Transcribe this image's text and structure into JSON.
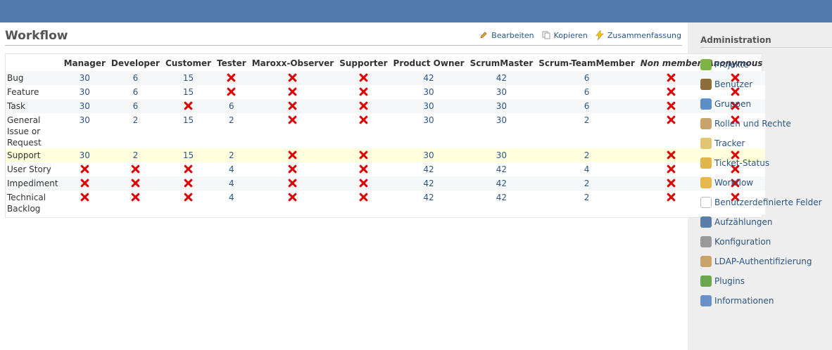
{
  "page": {
    "title": "Workflow",
    "actions": {
      "edit": "Bearbeiten",
      "copy": "Kopieren",
      "summary": "Zusammenfassung"
    }
  },
  "workflow": {
    "columns": [
      "Manager",
      "Developer",
      "Customer",
      "Tester",
      "Maroxx-Observer",
      "Supporter",
      "Product Owner",
      "ScrumMaster",
      "Scrum-TeamMember",
      "Non member",
      "Anonymous"
    ],
    "rows": [
      {
        "label": "Bug",
        "values": [
          "30",
          "6",
          "15",
          "x",
          "x",
          "x",
          "42",
          "42",
          "6",
          "x",
          "x"
        ]
      },
      {
        "label": "Feature",
        "values": [
          "30",
          "6",
          "15",
          "x",
          "x",
          "x",
          "30",
          "30",
          "6",
          "x",
          "x"
        ]
      },
      {
        "label": "Task",
        "values": [
          "30",
          "6",
          "x",
          "6",
          "x",
          "x",
          "30",
          "30",
          "6",
          "x",
          "x"
        ]
      },
      {
        "label": "General Issue or Request",
        "values": [
          "30",
          "2",
          "15",
          "2",
          "x",
          "x",
          "30",
          "30",
          "2",
          "x",
          "x"
        ]
      },
      {
        "label": "Support",
        "values": [
          "30",
          "2",
          "15",
          "2",
          "x",
          "x",
          "30",
          "30",
          "2",
          "x",
          "x"
        ]
      },
      {
        "label": "User Story",
        "values": [
          "x",
          "x",
          "x",
          "4",
          "x",
          "x",
          "42",
          "42",
          "4",
          "x",
          "x"
        ]
      },
      {
        "label": "Impediment",
        "values": [
          "x",
          "x",
          "x",
          "4",
          "x",
          "x",
          "42",
          "42",
          "2",
          "x",
          "x"
        ]
      },
      {
        "label": "Technical Backlog",
        "values": [
          "x",
          "x",
          "x",
          "4",
          "x",
          "x",
          "42",
          "42",
          "2",
          "x",
          "x"
        ]
      }
    ]
  },
  "sidebar": {
    "title": "Administration",
    "items": [
      {
        "label": "Projekte",
        "icon": "projects-icon",
        "color": "#7cb342"
      },
      {
        "label": "Benutzer",
        "icon": "user-icon",
        "color": "#8d6e3a"
      },
      {
        "label": "Gruppen",
        "icon": "group-icon",
        "color": "#5c8fc7"
      },
      {
        "label": "Rollen und Rechte",
        "icon": "roles-icon",
        "color": "#c9a46a"
      },
      {
        "label": "Tracker",
        "icon": "tracker-icon",
        "color": "#e2c572"
      },
      {
        "label": "Ticket-Status",
        "icon": "ticket-status-icon",
        "color": "#e0b64a"
      },
      {
        "label": "Workflow",
        "icon": "workflow-icon",
        "color": "#e6b94a"
      },
      {
        "label": "Benutzerdefinierte Felder",
        "icon": "custom-fields-icon",
        "color": "#ffffff"
      },
      {
        "label": "Aufzählungen",
        "icon": "enumerations-icon",
        "color": "#5a7ea8"
      },
      {
        "label": "Konfiguration",
        "icon": "settings-icon",
        "color": "#9a9a9a"
      },
      {
        "label": "LDAP-Authentifizierung",
        "icon": "ldap-icon",
        "color": "#c9a46a"
      },
      {
        "label": "Plugins",
        "icon": "plugins-icon",
        "color": "#6aa84f"
      },
      {
        "label": "Informationen",
        "icon": "info-icon",
        "color": "#6b8fc9"
      }
    ]
  },
  "colors": {
    "header": "#507aaa",
    "link": "#2a5685",
    "highlight_row": "#ffffdd"
  }
}
